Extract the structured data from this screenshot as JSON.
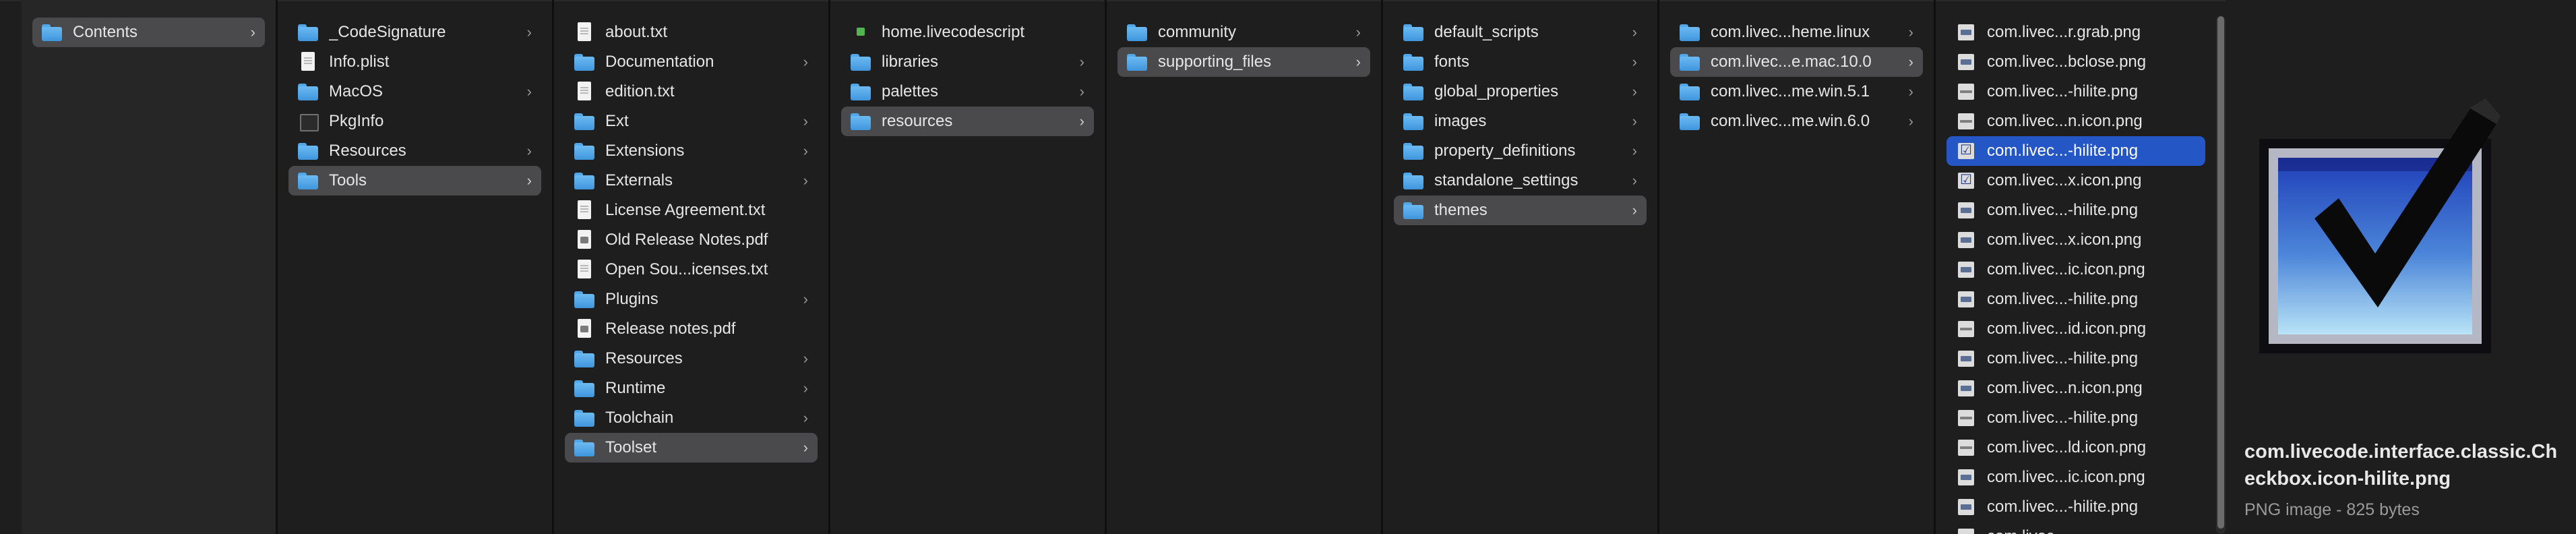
{
  "columns": [
    {
      "items": [
        {
          "label": "Contents",
          "icon": "folder",
          "chevron": true,
          "selected": true
        }
      ]
    },
    {
      "items": [
        {
          "label": "_CodeSignature",
          "icon": "folder",
          "chevron": true
        },
        {
          "label": "Info.plist",
          "icon": "doc"
        },
        {
          "label": "MacOS",
          "icon": "folder",
          "chevron": true
        },
        {
          "label": "PkgInfo",
          "icon": "blank"
        },
        {
          "label": "Resources",
          "icon": "folder",
          "chevron": true
        },
        {
          "label": "Tools",
          "icon": "folder",
          "chevron": true,
          "selected": true
        }
      ]
    },
    {
      "items": [
        {
          "label": "about.txt",
          "icon": "doc"
        },
        {
          "label": "Documentation",
          "icon": "folder",
          "chevron": true
        },
        {
          "label": "edition.txt",
          "icon": "doc"
        },
        {
          "label": "Ext",
          "icon": "folder",
          "chevron": true
        },
        {
          "label": "Extensions",
          "icon": "folder",
          "chevron": true
        },
        {
          "label": "Externals",
          "icon": "folder",
          "chevron": true
        },
        {
          "label": "License Agreement.txt",
          "icon": "doc"
        },
        {
          "label": "Old Release Notes.pdf",
          "icon": "pdf"
        },
        {
          "label": "Open Sou...icenses.txt",
          "icon": "doc"
        },
        {
          "label": "Plugins",
          "icon": "folder",
          "chevron": true
        },
        {
          "label": "Release notes.pdf",
          "icon": "pdf"
        },
        {
          "label": "Resources",
          "icon": "folder",
          "chevron": true
        },
        {
          "label": "Runtime",
          "icon": "folder",
          "chevron": true
        },
        {
          "label": "Toolchain",
          "icon": "folder",
          "chevron": true
        },
        {
          "label": "Toolset",
          "icon": "folder",
          "chevron": true,
          "selected": true
        }
      ]
    },
    {
      "items": [
        {
          "label": "home.livecodescript",
          "icon": "script"
        },
        {
          "label": "libraries",
          "icon": "folder",
          "chevron": true
        },
        {
          "label": "palettes",
          "icon": "folder",
          "chevron": true
        },
        {
          "label": "resources",
          "icon": "folder",
          "chevron": true,
          "selected": true
        }
      ]
    },
    {
      "items": [
        {
          "label": "community",
          "icon": "folder",
          "chevron": true
        },
        {
          "label": "supporting_files",
          "icon": "folder",
          "chevron": true,
          "selected": true
        }
      ]
    },
    {
      "items": [
        {
          "label": "default_scripts",
          "icon": "folder",
          "chevron": true
        },
        {
          "label": "fonts",
          "icon": "folder",
          "chevron": true
        },
        {
          "label": "global_properties",
          "icon": "folder",
          "chevron": true
        },
        {
          "label": "images",
          "icon": "folder",
          "chevron": true
        },
        {
          "label": "property_definitions",
          "icon": "folder",
          "chevron": true
        },
        {
          "label": "standalone_settings",
          "icon": "folder",
          "chevron": true
        },
        {
          "label": "themes",
          "icon": "folder",
          "chevron": true,
          "selected": true
        }
      ]
    },
    {
      "items": [
        {
          "label": "com.livec...heme.linux",
          "icon": "folder",
          "chevron": true
        },
        {
          "label": "com.livec...e.mac.10.0",
          "icon": "folder",
          "chevron": true,
          "selected": true
        },
        {
          "label": "com.livec...me.win.5.1",
          "icon": "folder",
          "chevron": true
        },
        {
          "label": "com.livec...me.win.6.0",
          "icon": "folder",
          "chevron": true
        }
      ]
    },
    {
      "items": [
        {
          "label": "com.livec...r.grab.png",
          "icon": "png"
        },
        {
          "label": "com.livec...bclose.png",
          "icon": "png"
        },
        {
          "label": "com.livec...-hilite.png",
          "icon": "png-thin"
        },
        {
          "label": "com.livec...n.icon.png",
          "icon": "png-thin"
        },
        {
          "label": "com.livec...-hilite.png",
          "icon": "png-check",
          "active": true
        },
        {
          "label": "com.livec...x.icon.png",
          "icon": "png-check"
        },
        {
          "label": "com.livec...-hilite.png",
          "icon": "png"
        },
        {
          "label": "com.livec...x.icon.png",
          "icon": "png"
        },
        {
          "label": "com.livec...ic.icon.png",
          "icon": "png"
        },
        {
          "label": "com.livec...-hilite.png",
          "icon": "png"
        },
        {
          "label": "com.livec...id.icon.png",
          "icon": "png-thin"
        },
        {
          "label": "com.livec...-hilite.png",
          "icon": "png"
        },
        {
          "label": "com.livec...n.icon.png",
          "icon": "png"
        },
        {
          "label": "com.livec...-hilite.png",
          "icon": "png-thin"
        },
        {
          "label": "com.livec...ld.icon.png",
          "icon": "png-thin"
        },
        {
          "label": "com.livec...ic.icon.png",
          "icon": "png"
        },
        {
          "label": "com.livec...-hilite.png",
          "icon": "png"
        },
        {
          "label": "com.livec...",
          "icon": "png"
        }
      ]
    }
  ],
  "preview": {
    "file_name": "com.livecode.interface.classic.Checkbox.icon-hilite.png",
    "meta": "PNG image - 825 bytes",
    "image_icon": "checkbox-checked-icon"
  },
  "colors": {
    "folder": "#52a7e9",
    "selection_active": "#2457c5",
    "selection_inactive": "#4a4a4c",
    "background": "#1e1e1e"
  }
}
